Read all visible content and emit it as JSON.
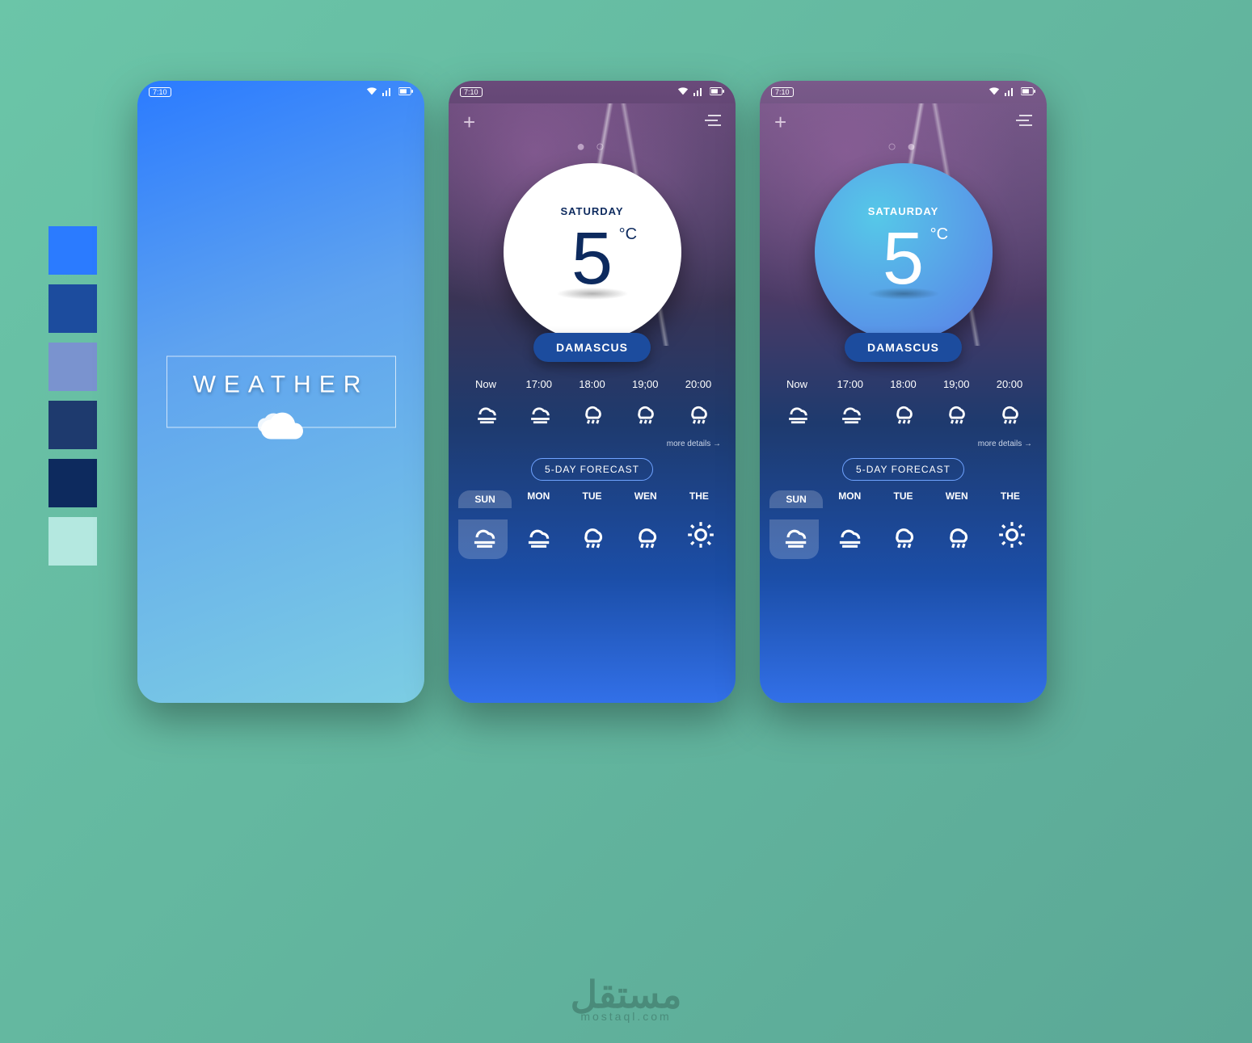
{
  "palette": [
    "#2B7BFF",
    "#1C4C9E",
    "#7A93CF",
    "#1E3A6E",
    "#0D2A5E",
    "#B4E8E0"
  ],
  "splash": {
    "title": "WEATHER",
    "time": "7:10"
  },
  "status": {
    "time": "7:10"
  },
  "screen_a": {
    "day": "SATURDAY",
    "temp": "5",
    "unit": "°C",
    "city": "DAMASCUS",
    "dots": "● ○",
    "hourly": [
      {
        "t": "Now",
        "icon": "fog"
      },
      {
        "t": "17:00",
        "icon": "fog"
      },
      {
        "t": "18:00",
        "icon": "rain"
      },
      {
        "t": "19;00",
        "icon": "rain"
      },
      {
        "t": "20:00",
        "icon": "rain"
      }
    ],
    "more": "more details →",
    "forecast_title": "5-DAY FORECAST",
    "daily": [
      {
        "d": "SUN",
        "icon": "fog",
        "active": true
      },
      {
        "d": "MON",
        "icon": "fog",
        "active": false
      },
      {
        "d": "TUE",
        "icon": "rain",
        "active": false
      },
      {
        "d": "WEN",
        "icon": "rain",
        "active": false
      },
      {
        "d": "THE",
        "icon": "sun",
        "active": false
      }
    ]
  },
  "screen_b": {
    "day": "SATAURDAY",
    "temp": "5",
    "unit": "°C",
    "city": "DAMASCUS",
    "dots": "○ ●",
    "hourly": [
      {
        "t": "Now",
        "icon": "fog"
      },
      {
        "t": "17:00",
        "icon": "fog"
      },
      {
        "t": "18:00",
        "icon": "rain"
      },
      {
        "t": "19;00",
        "icon": "rain"
      },
      {
        "t": "20:00",
        "icon": "rain"
      }
    ],
    "more": "more details →",
    "forecast_title": "5-DAY FORECAST",
    "daily": [
      {
        "d": "SUN",
        "icon": "fog",
        "active": true
      },
      {
        "d": "MON",
        "icon": "fog",
        "active": false
      },
      {
        "d": "TUE",
        "icon": "rain",
        "active": false
      },
      {
        "d": "WEN",
        "icon": "rain",
        "active": false
      },
      {
        "d": "THE",
        "icon": "sun",
        "active": false
      }
    ]
  },
  "watermark": {
    "ar": "مستقل",
    "en": "mostaql.com"
  }
}
